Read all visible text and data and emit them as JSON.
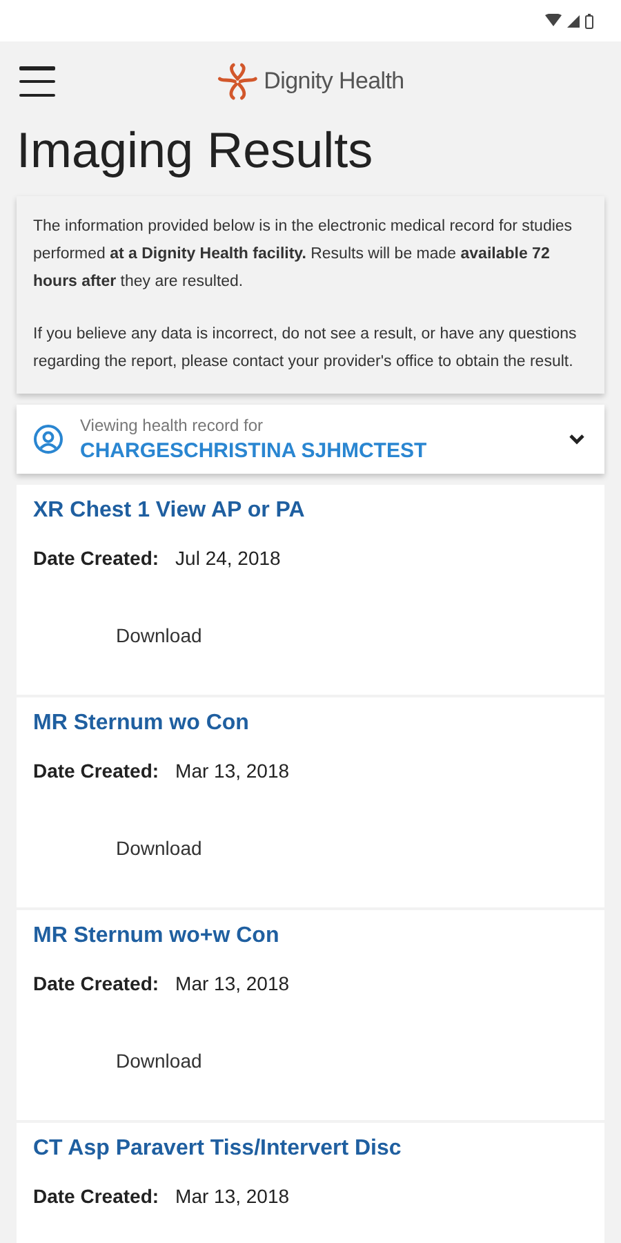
{
  "app_bar": {
    "logo_text": "Dignity Health"
  },
  "title": "Imaging Results",
  "notice": {
    "paragraphs": [
      "The information provided below is in the electronic medical record for studies performed **at a Dignity Health facility.** Results will be made **available 72 hours after** they are resulted.",
      "If you believe any data is incorrect, do not see a result, or have any questions regarding the report, please contact your provider's office to obtain the result."
    ]
  },
  "record_selector": {
    "label": "Viewing health record for",
    "name": "CHARGESCHRISTINA SJHMCTEST"
  },
  "results": [
    {
      "name": "XR Chest 1 View AP or PA",
      "date_label": "Date Created:",
      "date": "Jul 24, 2018",
      "action": "Download"
    },
    {
      "name": "MR Sternum wo Con",
      "date_label": "Date Created:",
      "date": "Mar 13, 2018",
      "action": "Download"
    },
    {
      "name": "MR Sternum wo+w Con",
      "date_label": "Date Created:",
      "date": "Mar 13, 2018",
      "action": "Download"
    },
    {
      "name": "CT Asp Paravert Tiss/Intervert Disc",
      "date_label": "Date Created:",
      "date": "Mar 13, 2018"
    }
  ]
}
